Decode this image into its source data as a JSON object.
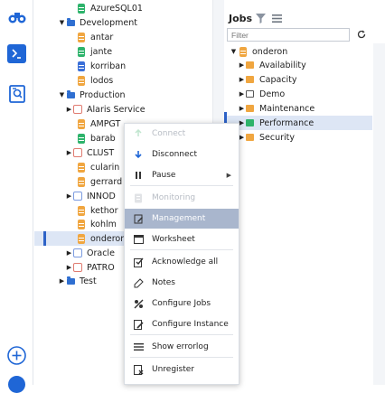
{
  "rail": {
    "icons": [
      "binoculars-icon",
      "terminal-icon",
      "report-icon",
      "add-icon"
    ]
  },
  "tree": {
    "items": [
      {
        "label": "AzureSQL01",
        "icon": "database-icon",
        "color": "#2db36b",
        "arrow": ""
      },
      {
        "label": "Development",
        "icon": "folder-icon",
        "color": "#2f6fd1",
        "arrow": "▼"
      },
      {
        "label": "antar",
        "icon": "database-icon",
        "color": "#f0a640",
        "arrow": ""
      },
      {
        "label": "jante",
        "icon": "database-icon",
        "color": "#2db36b",
        "arrow": ""
      },
      {
        "label": "korriban",
        "icon": "database-icon",
        "color": "#3a6fd8",
        "arrow": ""
      },
      {
        "label": "lodos",
        "icon": "database-icon",
        "color": "#f0a640",
        "arrow": ""
      },
      {
        "label": "Production",
        "icon": "folder-icon",
        "color": "#2f6fd1",
        "arrow": "▼"
      },
      {
        "label": "Alaris Service",
        "icon": "cluster-icon",
        "color": "#e07b70",
        "arrow": "▶"
      },
      {
        "label": "AMPGT",
        "icon": "database-icon",
        "color": "#f0a640",
        "arrow": ""
      },
      {
        "label": "barab",
        "icon": "database-icon",
        "color": "#2db36b",
        "arrow": ""
      },
      {
        "label": "CLUST",
        "icon": "cluster-icon",
        "color": "#e07b70",
        "arrow": "▶"
      },
      {
        "label": "cularin",
        "icon": "database-icon",
        "color": "#f0a640",
        "arrow": ""
      },
      {
        "label": "gerrard",
        "icon": "database-icon",
        "color": "#f0a640",
        "arrow": ""
      },
      {
        "label": "INNOD",
        "icon": "cluster-icon",
        "color": "#7b9be0",
        "arrow": "▶"
      },
      {
        "label": "kethor",
        "icon": "database-icon",
        "color": "#f0a640",
        "arrow": ""
      },
      {
        "label": "kohlm",
        "icon": "database-icon",
        "color": "#f0a640",
        "arrow": ""
      },
      {
        "label": "onderon",
        "icon": "database-icon",
        "color": "#f0a640",
        "arrow": "",
        "selected": true
      },
      {
        "label": "Oracle",
        "icon": "cluster-icon",
        "color": "#7b9be0",
        "arrow": "▶"
      },
      {
        "label": "PATRO",
        "icon": "cluster-icon",
        "color": "#e07b70",
        "arrow": "▶"
      },
      {
        "label": "Test",
        "icon": "folder-icon",
        "color": "#2f6fd1",
        "arrow": "▶"
      }
    ]
  },
  "jobs": {
    "title": "Jobs",
    "filter_placeholder": "Filter",
    "root": {
      "label": "onderon",
      "color": "#f0a640"
    },
    "folders": [
      {
        "label": "Availability",
        "color": "#f0a640"
      },
      {
        "label": "Capacity",
        "color": "#f0a640"
      },
      {
        "label": "Demo",
        "color": "#ffffff"
      },
      {
        "label": "Maintenance",
        "color": "#f0a640"
      },
      {
        "label": "Performance",
        "color": "#2db36b",
        "selected": true
      },
      {
        "label": "Security",
        "color": "#f0a640"
      }
    ]
  },
  "context_menu": {
    "items": [
      {
        "label": "Connect",
        "icon": "connect-icon",
        "disabled": true
      },
      {
        "label": "Disconnect",
        "icon": "disconnect-icon"
      },
      {
        "label": "Pause",
        "icon": "pause-icon",
        "submenu": "▶"
      },
      {
        "label": "Monitoring",
        "icon": "monitoring-icon",
        "disabled": true
      },
      {
        "label": "Management",
        "icon": "management-icon",
        "hover": true
      },
      {
        "label": "Worksheet",
        "icon": "worksheet-icon"
      },
      {
        "label": "Acknowledge all",
        "icon": "acknowledge-icon"
      },
      {
        "label": "Notes",
        "icon": "notes-icon"
      },
      {
        "label": "Configure Jobs",
        "icon": "configure-jobs-icon"
      },
      {
        "label": "Configure Instance",
        "icon": "configure-instance-icon"
      },
      {
        "label": "Show errorlog",
        "icon": "errorlog-icon"
      },
      {
        "label": "Unregister",
        "icon": "unregister-icon"
      }
    ]
  }
}
